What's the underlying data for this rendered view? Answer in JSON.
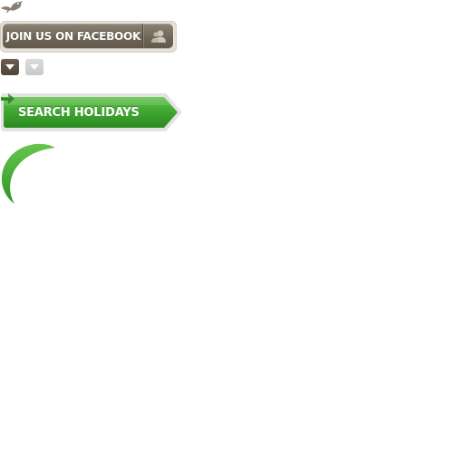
{
  "bird": {
    "icon": "bird-icon"
  },
  "facebook": {
    "label": "JOIN US ON FACEBOOK",
    "icon": "user-silhouette-icon"
  },
  "toggles": [
    {
      "icon": "chevron-down-icon",
      "state": "active"
    },
    {
      "icon": "chevron-down-icon",
      "state": "inactive"
    }
  ],
  "search": {
    "label": "SEARCH HOLIDAYS",
    "icon": "arrow-right-icon"
  },
  "spinner": {
    "icon": "crescent-spinner-icon"
  },
  "colors": {
    "brand_brown": "#6f6557",
    "brand_green": "#3fa52f",
    "inactive_grey": "#cfcfcf"
  }
}
